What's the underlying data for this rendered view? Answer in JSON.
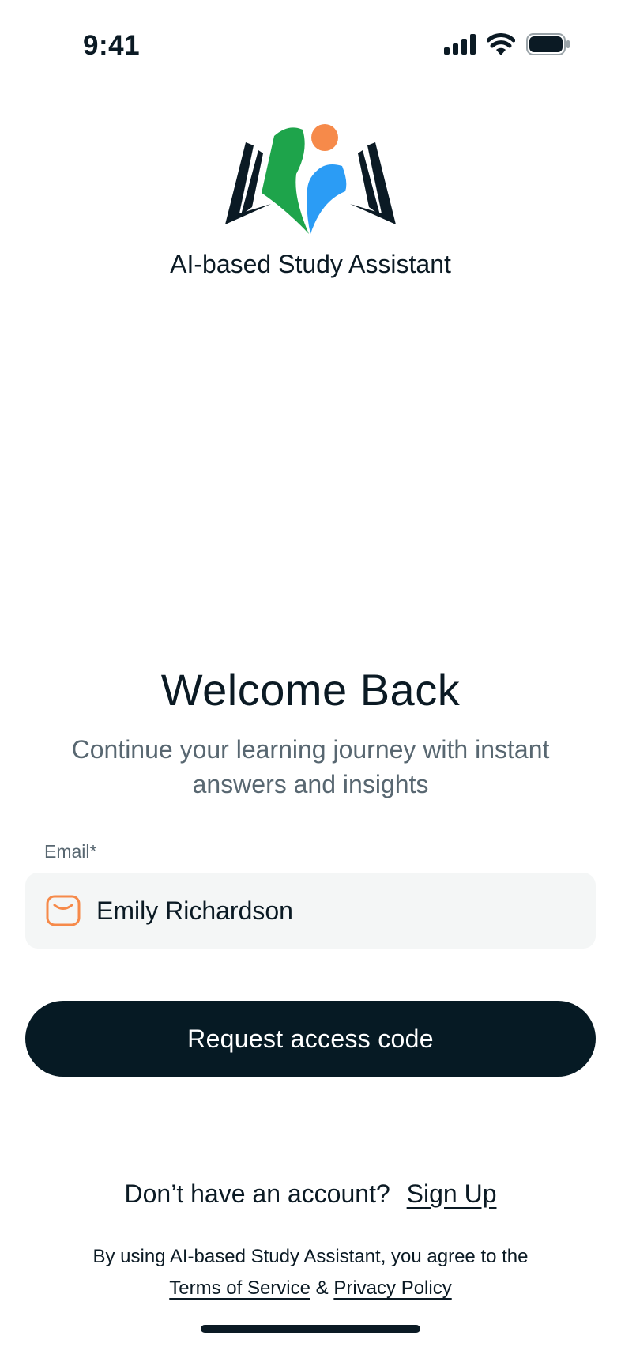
{
  "status_bar": {
    "time": "9:41",
    "icons": [
      "cellular-signal-icon",
      "wifi-icon",
      "battery-icon"
    ]
  },
  "brand": {
    "app_name": "AI-based Study Assistant",
    "logo_icon": "open-book-learners-logo",
    "colors": {
      "green": "#1ea44b",
      "blue": "#2b9cf5",
      "orange": "#f68a4a",
      "dark": "#0b1a24"
    }
  },
  "welcome": {
    "title": "Welcome Back",
    "subtitle": "Continue your learning journey with instant answers and insights"
  },
  "email": {
    "label": "Email*",
    "value": "Emily Richardson",
    "icon": "mail-icon",
    "icon_color": "#f68a4a"
  },
  "cta": {
    "label": "Request access code",
    "color": "#061a24"
  },
  "footer": {
    "signup_prompt": "Don’t have an account?",
    "signup_link": "Sign Up",
    "legal_prefix": "By using AI-based Study Assistant, you agree to the",
    "terms_link": "Terms of Service",
    "ampersand": "&",
    "privacy_link": "Privacy Policy"
  }
}
